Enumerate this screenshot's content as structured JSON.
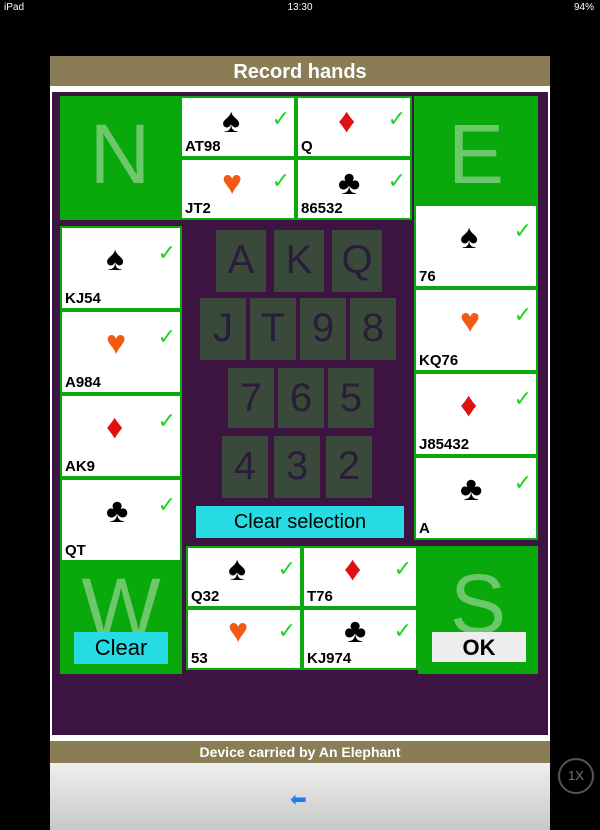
{
  "status_bar": {
    "device": "iPad",
    "time": "13:30",
    "battery": "94%"
  },
  "title": "Record hands",
  "seats": {
    "north": "N",
    "east": "E",
    "west": "W",
    "south": "S"
  },
  "hands": {
    "north": {
      "spades": {
        "suit": "spades",
        "holding": "AT98"
      },
      "diamonds": {
        "suit": "diamonds",
        "holding": "Q"
      },
      "hearts": {
        "suit": "hearts",
        "holding": "JT2"
      },
      "clubs": {
        "suit": "clubs",
        "holding": "86532"
      }
    },
    "east": {
      "spades": {
        "suit": "spades",
        "holding": "76"
      },
      "hearts": {
        "suit": "hearts",
        "holding": "KQ76"
      },
      "diamonds": {
        "suit": "diamonds",
        "holding": "J85432"
      },
      "clubs": {
        "suit": "clubs",
        "holding": "A"
      }
    },
    "west": {
      "spades": {
        "suit": "spades",
        "holding": "KJ54"
      },
      "hearts": {
        "suit": "hearts",
        "holding": "A984"
      },
      "diamonds": {
        "suit": "diamonds",
        "holding": "AK9"
      },
      "clubs": {
        "suit": "clubs",
        "holding": "QT"
      }
    },
    "south": {
      "spades": {
        "suit": "spades",
        "holding": "Q32"
      },
      "diamonds": {
        "suit": "diamonds",
        "holding": "T76"
      },
      "hearts": {
        "suit": "hearts",
        "holding": "53"
      },
      "clubs": {
        "suit": "clubs",
        "holding": "KJ974"
      }
    }
  },
  "rank_buttons": [
    "A",
    "K",
    "Q",
    "J",
    "T",
    "9",
    "8",
    "7",
    "6",
    "5",
    "4",
    "3",
    "2"
  ],
  "buttons": {
    "clear_selection": "Clear selection",
    "clear": "Clear",
    "ok": "OK"
  },
  "footer": "Device carried by An Elephant",
  "speed_label": "1X",
  "icons": {
    "check": "check-icon",
    "back": "back-arrow-icon"
  },
  "colors": {
    "green": "#09a80b",
    "board": "#3d1342",
    "cyan": "#27dbe2",
    "bar": "#8a7d55"
  }
}
